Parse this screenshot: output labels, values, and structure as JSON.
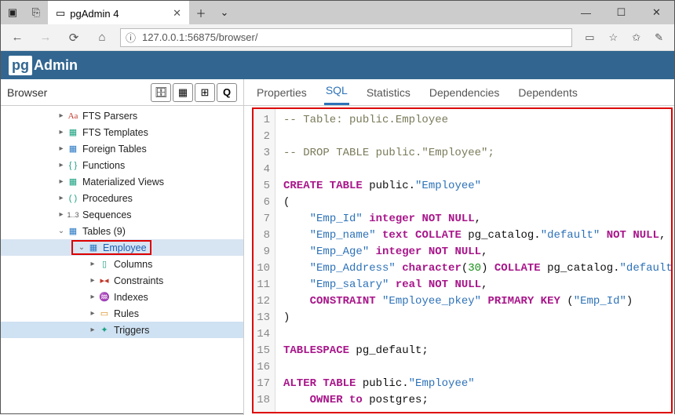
{
  "window": {
    "tab_title": "pgAdmin 4",
    "url": "127.0.0.1:56875/browser/"
  },
  "header": {
    "logo_text": "pg",
    "brand_text": "Admin"
  },
  "browser": {
    "title": "Browser",
    "tree": {
      "fts_parsers": "FTS Parsers",
      "fts_templates": "FTS Templates",
      "foreign_tables": "Foreign Tables",
      "functions": "Functions",
      "materialized_views": "Materialized Views",
      "procedures": "Procedures",
      "sequences": "Sequences",
      "tables": "Tables (9)",
      "employee": "Employee",
      "columns": "Columns",
      "constraints": "Constraints",
      "indexes": "Indexes",
      "rules": "Rules",
      "triggers": "Triggers"
    }
  },
  "icons": {
    "fts_parsers": "Aa",
    "sequences": "1..3"
  },
  "tabs": {
    "properties": "Properties",
    "sql": "SQL",
    "statistics": "Statistics",
    "dependencies": "Dependencies",
    "dependents": "Dependents"
  },
  "sql": {
    "line_count": 18,
    "lines": [
      {
        "type": "comment",
        "text": "-- Table: public.Employee"
      },
      {
        "type": "blank",
        "text": ""
      },
      {
        "type": "comment",
        "text": "-- DROP TABLE public.\"Employee\";"
      },
      {
        "type": "blank",
        "text": ""
      },
      {
        "type": "stmt",
        "segments": [
          [
            "kw",
            "CREATE TABLE "
          ],
          [
            "plain",
            "public."
          ],
          [
            "str",
            "\"Employee\""
          ]
        ]
      },
      {
        "type": "plain",
        "text": "("
      },
      {
        "type": "stmt",
        "segments": [
          [
            "plain",
            "    "
          ],
          [
            "str",
            "\"Emp_Id\""
          ],
          [
            "plain",
            " "
          ],
          [
            "kw",
            "integer"
          ],
          [
            "plain",
            " "
          ],
          [
            "kw2",
            "NOT NULL"
          ],
          [
            "plain",
            ","
          ]
        ]
      },
      {
        "type": "stmt",
        "segments": [
          [
            "plain",
            "    "
          ],
          [
            "str",
            "\"Emp_name\""
          ],
          [
            "plain",
            " "
          ],
          [
            "kw",
            "text"
          ],
          [
            "plain",
            " "
          ],
          [
            "kw2",
            "COLLATE"
          ],
          [
            "plain",
            " pg_catalog."
          ],
          [
            "str",
            "\"default\""
          ],
          [
            "plain",
            " "
          ],
          [
            "kw2",
            "NOT NULL"
          ],
          [
            "plain",
            ","
          ]
        ]
      },
      {
        "type": "stmt",
        "segments": [
          [
            "plain",
            "    "
          ],
          [
            "str",
            "\"Emp_Age\""
          ],
          [
            "plain",
            " "
          ],
          [
            "kw",
            "integer"
          ],
          [
            "plain",
            " "
          ],
          [
            "kw2",
            "NOT NULL"
          ],
          [
            "plain",
            ","
          ]
        ]
      },
      {
        "type": "stmt",
        "segments": [
          [
            "plain",
            "    "
          ],
          [
            "str",
            "\"Emp_Address\""
          ],
          [
            "plain",
            " "
          ],
          [
            "kw",
            "character"
          ],
          [
            "plain",
            "("
          ],
          [
            "num",
            "30"
          ],
          [
            "plain",
            ") "
          ],
          [
            "kw2",
            "COLLATE"
          ],
          [
            "plain",
            " pg_catalog."
          ],
          [
            "str",
            "\"default\""
          ],
          [
            "plain",
            ","
          ]
        ]
      },
      {
        "type": "stmt",
        "segments": [
          [
            "plain",
            "    "
          ],
          [
            "str",
            "\"Emp_salary\""
          ],
          [
            "plain",
            " "
          ],
          [
            "kw",
            "real"
          ],
          [
            "plain",
            " "
          ],
          [
            "kw2",
            "NOT NULL"
          ],
          [
            "plain",
            ","
          ]
        ]
      },
      {
        "type": "stmt",
        "segments": [
          [
            "plain",
            "    "
          ],
          [
            "kw2",
            "CONSTRAINT"
          ],
          [
            "plain",
            " "
          ],
          [
            "str",
            "\"Employee_pkey\""
          ],
          [
            "plain",
            " "
          ],
          [
            "kw2",
            "PRIMARY KEY"
          ],
          [
            "plain",
            " ("
          ],
          [
            "str",
            "\"Emp_Id\""
          ],
          [
            "plain",
            ")"
          ]
        ]
      },
      {
        "type": "plain",
        "text": ")"
      },
      {
        "type": "blank",
        "text": ""
      },
      {
        "type": "stmt",
        "segments": [
          [
            "kw2",
            "TABLESPACE"
          ],
          [
            "plain",
            " pg_default;"
          ]
        ]
      },
      {
        "type": "blank",
        "text": ""
      },
      {
        "type": "stmt",
        "segments": [
          [
            "kw",
            "ALTER TABLE "
          ],
          [
            "plain",
            "public."
          ],
          [
            "str",
            "\"Employee\""
          ]
        ]
      },
      {
        "type": "stmt",
        "segments": [
          [
            "plain",
            "    "
          ],
          [
            "kw2",
            "OWNER to"
          ],
          [
            "plain",
            " postgres;"
          ]
        ]
      }
    ]
  }
}
